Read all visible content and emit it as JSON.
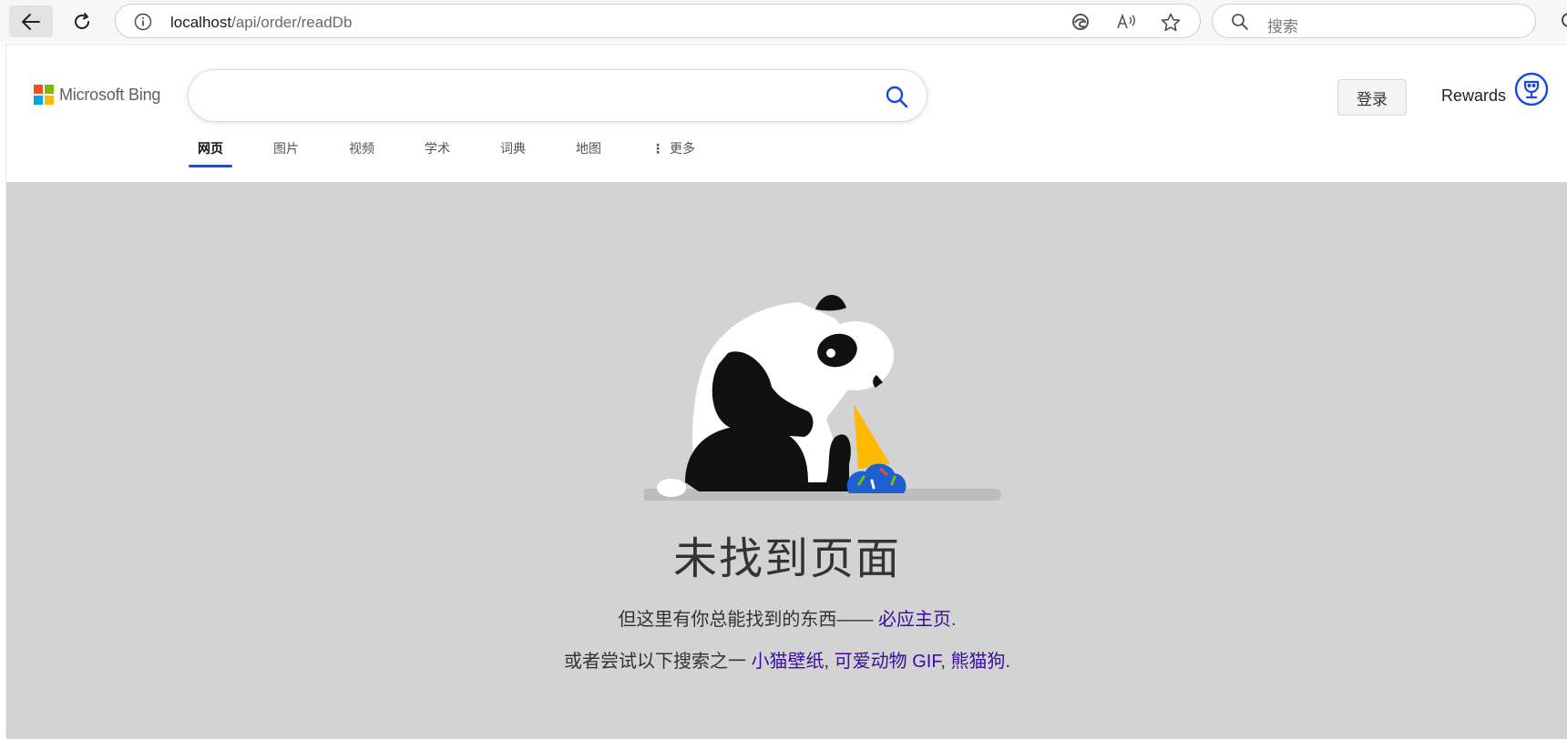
{
  "browser": {
    "url_host": "localhost",
    "url_path": "/api/order/readDb",
    "search_placeholder": "搜索"
  },
  "bing": {
    "logo_text": "Microsoft Bing",
    "search_value": "",
    "login_label": "登录",
    "rewards_label": "Rewards",
    "tabs": [
      {
        "label": "网页",
        "active": true
      },
      {
        "label": "图片",
        "active": false
      },
      {
        "label": "视频",
        "active": false
      },
      {
        "label": "学术",
        "active": false
      },
      {
        "label": "词典",
        "active": false
      },
      {
        "label": "地图",
        "active": false
      },
      {
        "label": "更多",
        "active": false
      }
    ],
    "logo_colors": [
      "#f25022",
      "#7fba00",
      "#00a4ef",
      "#ffb900"
    ],
    "accent": "#174ae4"
  },
  "error": {
    "title": "未找到页面",
    "line1_prefix": "但这里有你总能找到的东西——",
    "line1_link": "必应主页",
    "line1_suffix": ".",
    "line2_prefix": "或者尝试以下搜索之一",
    "links": [
      "小猫壁纸",
      "可爱动物 GIF",
      "熊猫狗"
    ],
    "sep": ", ",
    "end": ".",
    "link_color": "#3a0ca3",
    "background": "#d3d3d3"
  }
}
